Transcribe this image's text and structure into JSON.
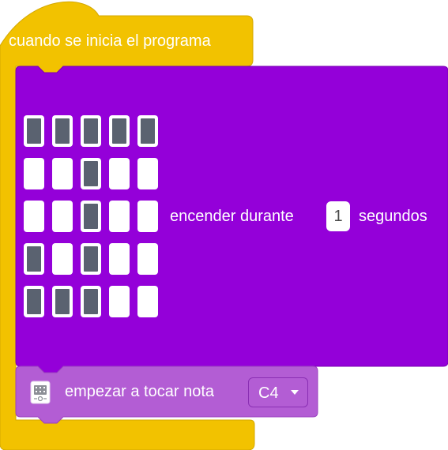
{
  "hat_block": {
    "label": "cuando se inicia el programa",
    "color": "#f2c200"
  },
  "show_block": {
    "label_before": "encender durante",
    "duration_value": "1",
    "label_after": "segundos",
    "color": "#9400d9",
    "leds": [
      [
        1,
        1,
        1,
        1,
        1
      ],
      [
        0,
        0,
        1,
        0,
        0
      ],
      [
        0,
        0,
        1,
        0,
        0
      ],
      [
        1,
        0,
        1,
        0,
        0
      ],
      [
        1,
        1,
        1,
        0,
        0
      ]
    ]
  },
  "note_block": {
    "icon": "microbit-icon",
    "label": "empezar a tocar nota",
    "note_value": "C4",
    "color": "#b35dd4"
  }
}
